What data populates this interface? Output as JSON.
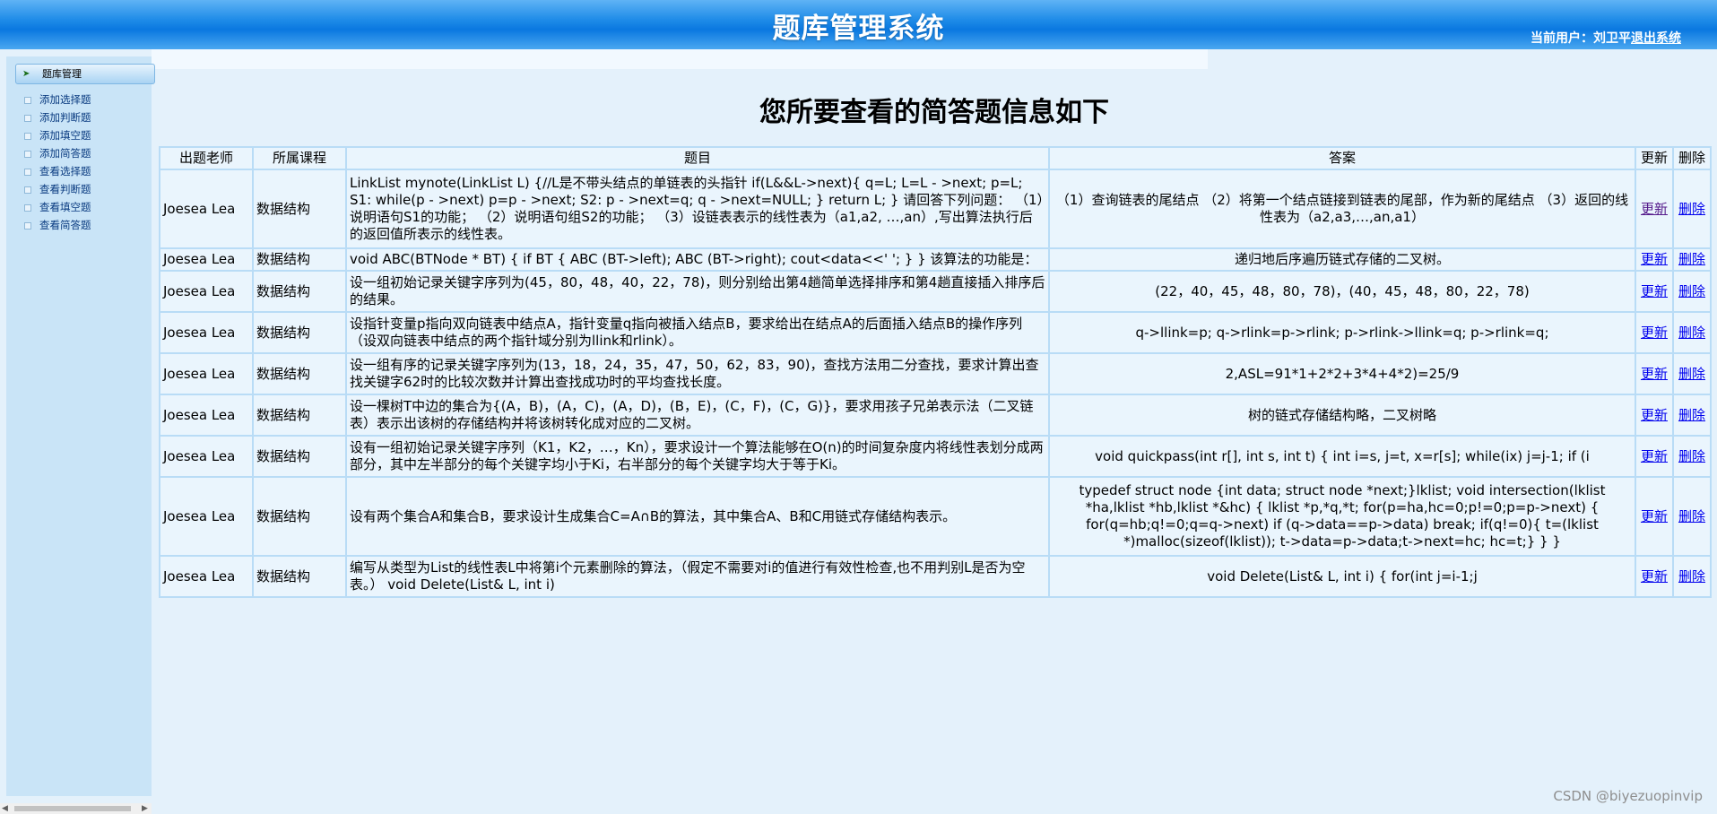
{
  "header": {
    "title": "题库管理系统",
    "current_user_label": "当前用户：",
    "current_user": "刘卫平",
    "logout": "退出系统"
  },
  "sidebar": {
    "group_label": "题库管理",
    "items": [
      {
        "label": "添加选择题"
      },
      {
        "label": "添加判断题"
      },
      {
        "label": "添加填空题"
      },
      {
        "label": "添加简答题"
      },
      {
        "label": "查看选择题"
      },
      {
        "label": "查看判断题"
      },
      {
        "label": "查看填空题"
      },
      {
        "label": "查看简答题"
      }
    ]
  },
  "main": {
    "title": "您所要查看的简答题信息如下",
    "columns": [
      "出题老师",
      "所属课程",
      "题目",
      "答案",
      "更新",
      "删除"
    ],
    "update_label": "更新",
    "delete_label": "删除",
    "rows": [
      {
        "teacher": "Joesea Lea",
        "course": "数据结构",
        "question": "LinkList mynote(LinkList L) {//L是不带头结点的单链表的头指针 if(L&&L->next){ q=L; L=L - >next; p=L; S1: while(p - >next) p=p - >next; S2: p - >next=q; q - >next=NULL; } return L; } 请回答下列问题： （1）说明语句S1的功能； （2）说明语句组S2的功能； （3）设链表表示的线性表为（a1,a2, …,an）,写出算法执行后的返回值所表示的线性表。",
        "answer": "（1）查询链表的尾结点 （2）将第一个结点链接到链表的尾部，作为新的尾结点 （3）返回的线性表为（a2,a3,…,an,a1）"
      },
      {
        "teacher": "Joesea Lea",
        "course": "数据结构",
        "question": "void ABC(BTNode * BT) { if BT { ABC (BT->left); ABC (BT->right); cout<data<<' '; } } 该算法的功能是：",
        "answer": "递归地后序遍历链式存储的二叉树。"
      },
      {
        "teacher": "Joesea Lea",
        "course": "数据结构",
        "question": "设一组初始记录关键字序列为(45，80，48，40，22，78)，则分别给出第4趟简单选择排序和第4趟直接插入排序后的结果。",
        "answer": "(22，40，45，48，80，78)，(40，45，48，80，22，78)"
      },
      {
        "teacher": "Joesea Lea",
        "course": "数据结构",
        "question": "设指针变量p指向双向链表中结点A，指针变量q指向被插入结点B，要求给出在结点A的后面插入结点B的操作序列（设双向链表中结点的两个指针域分别为llink和rlink）。",
        "answer": "q->llink=p; q->rlink=p->rlink; p->rlink->llink=q; p->rlink=q;"
      },
      {
        "teacher": "Joesea Lea",
        "course": "数据结构",
        "question": "设一组有序的记录关键字序列为(13，18，24，35，47，50，62，83，90)，查找方法用二分查找，要求计算出查找关键字62时的比较次数并计算出查找成功时的平均查找长度。",
        "answer": "2,ASL=91*1+2*2+3*4+4*2)=25/9"
      },
      {
        "teacher": "Joesea Lea",
        "course": "数据结构",
        "question": "设一棵树T中边的集合为{(A，B)，(A，C)，(A，D)，(B，E)，(C，F)，(C，G)}，要求用孩子兄弟表示法（二叉链表）表示出该树的存储结构并将该树转化成对应的二叉树。",
        "answer": "树的链式存储结构略，二叉树略"
      },
      {
        "teacher": "Joesea Lea",
        "course": "数据结构",
        "question": "设有一组初始记录关键字序列（K1，K2，…，Kn），要求设计一个算法能够在O(n)的时间复杂度内将线性表划分成两部分，其中左半部分的每个关键字均小于Ki，右半部分的每个关键字均大于等于Ki。",
        "answer": "void quickpass(int r[], int s, int t) { int i=s, j=t, x=r[s]; while(ix) j=j-1; if (i"
      },
      {
        "teacher": "Joesea Lea",
        "course": "数据结构",
        "question": "设有两个集合A和集合B，要求设计生成集合C=A∩B的算法，其中集合A、B和C用链式存储结构表示。",
        "answer": "typedef struct node {int data; struct node *next;}lklist; void intersection(lklist *ha,lklist *hb,lklist *&hc) { lklist *p,*q,*t; for(p=ha,hc=0;p!=0;p=p->next) { for(q=hb;q!=0;q=q->next) if (q->data==p->data) break; if(q!=0){ t=(lklist *)malloc(sizeof(lklist)); t->data=p->data;t->next=hc; hc=t;} } }"
      },
      {
        "teacher": "Joesea Lea",
        "course": "数据结构",
        "question": "编写从类型为List的线性表L中将第i个元素删除的算法，（假定不需要对i的值进行有效性检查,也不用判别L是否为空表。） void Delete(List& L, int i)",
        "answer": "void Delete(List& L, int i) { for(int j=i-1;j"
      }
    ]
  },
  "watermark": "CSDN @biyezuopinvip"
}
